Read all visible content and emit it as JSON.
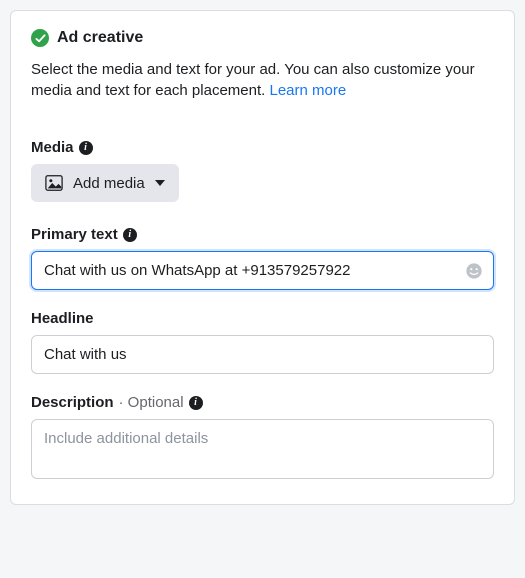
{
  "header": {
    "title": "Ad creative"
  },
  "subtitle": {
    "text": "Select the media and text for your ad. You can also customize your media and text for each placement. ",
    "link": "Learn more"
  },
  "media": {
    "label": "Media",
    "button": "Add media"
  },
  "primary_text": {
    "label": "Primary text",
    "value": "Chat with us on WhatsApp at +913579257922"
  },
  "headline": {
    "label": "Headline",
    "value": "Chat with us"
  },
  "description": {
    "label": "Description",
    "optional": "· Optional",
    "placeholder": "Include additional details"
  }
}
